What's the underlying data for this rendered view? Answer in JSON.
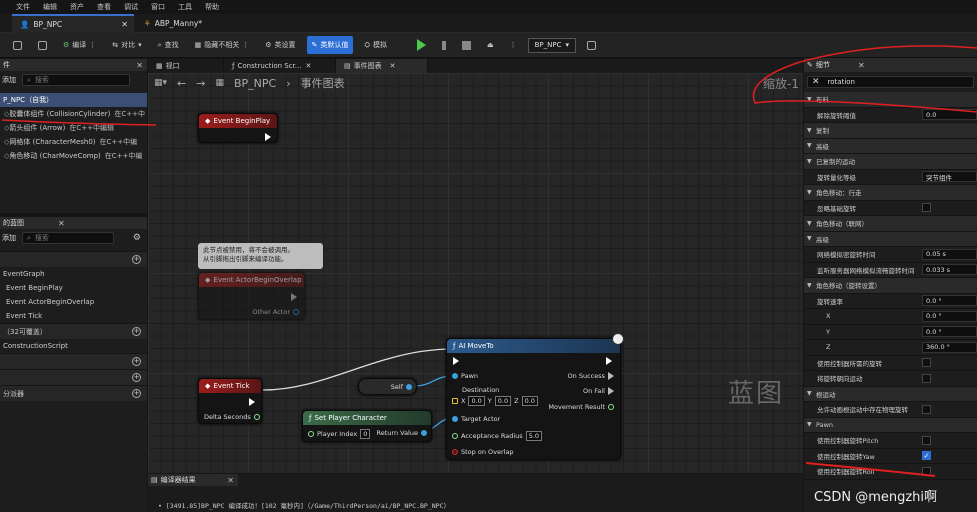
{
  "menu": [
    "文件",
    "编辑",
    "资产",
    "查看",
    "调试",
    "窗口",
    "工具",
    "帮助"
  ],
  "tabs": [
    {
      "label": "BP_NPC",
      "active": true
    },
    {
      "label": "ABP_Manny*",
      "active": false
    }
  ],
  "toolbar": {
    "compile": "编译",
    "diff": "对比",
    "find": "查找",
    "hide": "隐藏不相关",
    "class_settings": "类设置",
    "class_defaults": "类默认值",
    "simulate": "模拟",
    "debug_target": "BP_NPC"
  },
  "components": {
    "header": "件",
    "add": "添加",
    "search_placeholder": "搜索",
    "items": [
      {
        "label": "P_NPC（自我）",
        "note": ""
      },
      {
        "label": "胶囊体组件 (CollisionCylinder)",
        "note": "在C++中"
      },
      {
        "label": "箭头组件 (Arrow)",
        "note": "在C++中编辑"
      },
      {
        "label": "网格体 (CharacterMesh0)",
        "note": "在C++中编"
      },
      {
        "label": "角色移动 (CharMoveComp)",
        "note": "在C++中编"
      }
    ]
  },
  "mybp": {
    "header": "的蓝图",
    "add": "添加",
    "search_placeholder": "搜索",
    "items": [
      "EventGraph",
      "Event BeginPlay",
      "Event ActorBeginOverlap",
      "Event Tick"
    ],
    "cat_functions": "（32可覆盖）",
    "construction": "ConstructionScript",
    "cat_dispatchers": "分派器"
  },
  "graph": {
    "tabs": [
      "视口",
      "Construction Scr...",
      "事件图表"
    ],
    "breadcrumb_root": "BP_NPC",
    "breadcrumb_leaf": "事件图表",
    "zoom": "缩放-1",
    "watermark": "蓝图"
  },
  "nodes": {
    "beginplay": "Event BeginPlay",
    "overlap": "Event ActorBeginOverlap",
    "overlap_pin": "Other Actor",
    "comment_line1": "此节点被禁用，将不会被调用。",
    "comment_line2": "从引脚拖出引脚来编译功能。",
    "tick": "Event Tick",
    "tick_pin": "Delta Seconds",
    "self": "Self",
    "setplayer": "Set Player Character",
    "player_index": "Player Index",
    "player_index_val": "0",
    "return_value": "Return Value",
    "moveto": "AI MoveTo",
    "pawn": "Pawn",
    "destination": "Destination",
    "x": "X",
    "y": "Y",
    "z": "Z",
    "x_val": "0.0",
    "y_val": "0.0",
    "z_val": "0.0",
    "target_actor": "Target Actor",
    "acceptance": "Acceptance Radius",
    "acceptance_val": "5.0",
    "stop_overlap": "Stop on Overlap",
    "on_success": "On Success",
    "on_fail": "On Fail",
    "move_result": "Movement Result"
  },
  "output": {
    "header": "编译器结果",
    "line": "[3491.85]BP_NPC 编译成功！[102 毫秒内]（/Game/ThirdPerson/ai/BP_NPC.BP_NPC）"
  },
  "details": {
    "header": "细节",
    "search_value": "rotation",
    "rows": [
      {
        "type": "cat",
        "label": "布料"
      },
      {
        "type": "val",
        "label": "解除旋转阈值",
        "value": "0.0"
      },
      {
        "type": "cat",
        "label": "复制"
      },
      {
        "type": "cat",
        "label": "高级"
      },
      {
        "type": "cat",
        "label": "已复制的运动"
      },
      {
        "type": "val",
        "label": "旋转量化等级",
        "value": "突节组件"
      },
      {
        "type": "cat",
        "label": "角色移动：行走"
      },
      {
        "type": "chk",
        "label": "忽略基础旋转",
        "checked": false
      },
      {
        "type": "cat",
        "label": "角色移动（联网）"
      },
      {
        "type": "cat",
        "label": "高级"
      },
      {
        "type": "val",
        "label": "网络模拟密旋转时间",
        "value": "0.05 s"
      },
      {
        "type": "val",
        "label": "监听服务器网络模拟流畅旋转时间",
        "value": "0.033 s"
      },
      {
        "type": "cat",
        "label": "角色移动（旋转设置）"
      },
      {
        "type": "val",
        "label": "旋转速率",
        "value": "0.0 °"
      },
      {
        "type": "val",
        "label": "X",
        "value": "0.0 °"
      },
      {
        "type": "val",
        "label": "Y",
        "value": "0.0 °"
      },
      {
        "type": "val",
        "label": "Z",
        "value": "360.0 °"
      },
      {
        "type": "chk",
        "label": "使用控制器所需的旋转",
        "checked": false
      },
      {
        "type": "chk",
        "label": "将旋转朝向运动",
        "checked": false
      },
      {
        "type": "cat",
        "label": "根运动"
      },
      {
        "type": "chk",
        "label": "允许动画根运动中存在物理旋转",
        "checked": false
      },
      {
        "type": "cat",
        "label": "Pawn"
      },
      {
        "type": "chk",
        "label": "使用控制器旋转Pitch",
        "checked": false
      },
      {
        "type": "chk",
        "label": "使用控制器旋转Yaw",
        "checked": true
      },
      {
        "type": "chk",
        "label": "使用控制器旋转Roll",
        "checked": false
      }
    ]
  },
  "watermark_csdn": "CSDN @mengzhi啊"
}
